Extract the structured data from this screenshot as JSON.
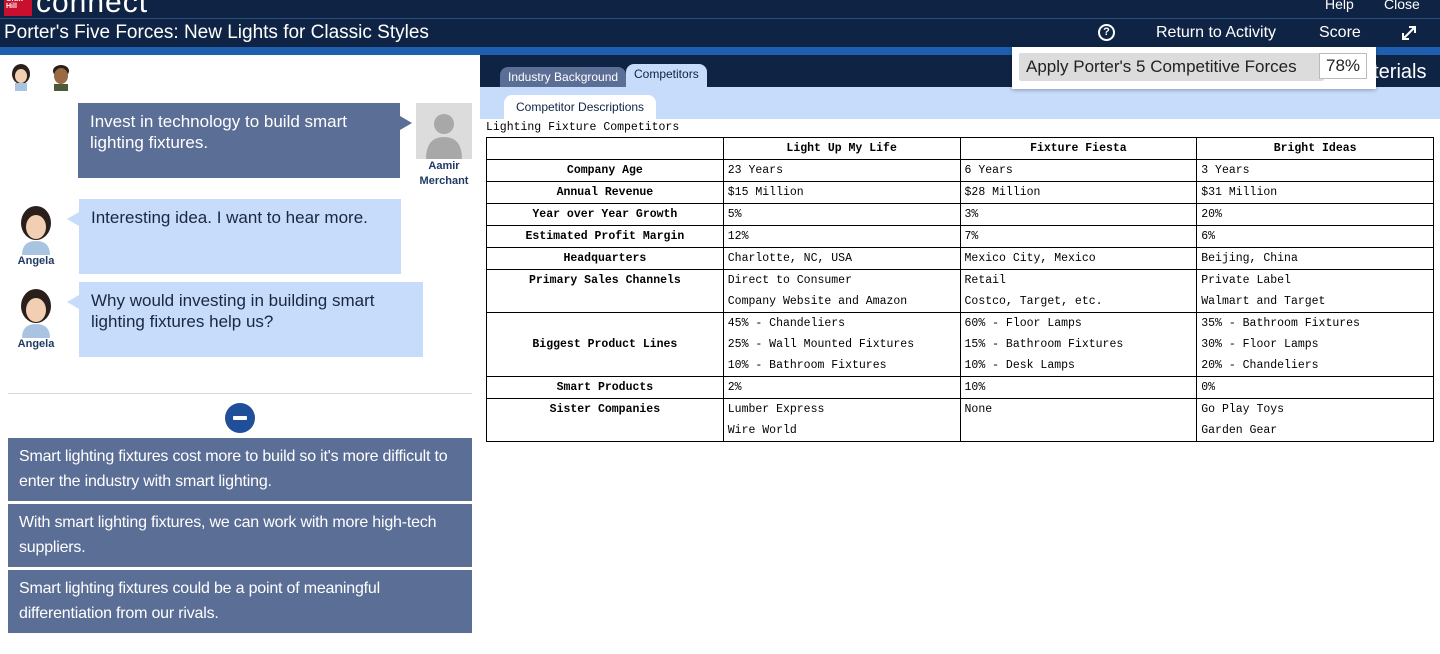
{
  "brand": {
    "logo_small": "Graw Hill",
    "logo_text": "connect",
    "help_label": "Help",
    "close_label": "Close"
  },
  "title_bar": {
    "title": "Porter's Five Forces: New Lights for Classic Styles",
    "help_symbol": "?",
    "return_label": "Return to Activity",
    "score_label": "Score"
  },
  "chat": {
    "messages": [
      {
        "speaker": "Aamir Merchant",
        "speaker_line1": "Aamir",
        "speaker_line2": "Merchant",
        "text": "Invest in technology to build smart lighting fixtures."
      },
      {
        "speaker": "Angela",
        "text": "Interesting idea. I want to hear more."
      },
      {
        "speaker": "Angela",
        "text": "Why would investing in building smart lighting fixtures help us?"
      }
    ],
    "options": [
      "Smart lighting fixtures cost more to build so it's more difficult to enter the industry with smart lighting.",
      "With smart lighting fixtures, we can work with more high-tech suppliers.",
      "Smart lighting fixtures could be a point of meaningful differentiation from our rivals."
    ]
  },
  "materials": {
    "tabs": [
      "Industry Background",
      "Competitors"
    ],
    "active_tab": "Competitors",
    "materials_label": "aterials",
    "subtab": "Competitor Descriptions"
  },
  "score_popup": {
    "label": "Apply Porter's 5 Competitive Forces",
    "value": "78%"
  },
  "table": {
    "caption": "Lighting Fixture Competitors",
    "columns": [
      "Light Up My Life",
      "Fixture Fiesta",
      "Bright Ideas"
    ],
    "rows": [
      {
        "label": "Company Age",
        "cells": [
          [
            "23 Years"
          ],
          [
            "6 Years"
          ],
          [
            "3 Years"
          ]
        ]
      },
      {
        "label": "Annual Revenue",
        "cells": [
          [
            "$15 Million"
          ],
          [
            "$28 Million"
          ],
          [
            "$31 Million"
          ]
        ]
      },
      {
        "label": "Year over Year Growth",
        "cells": [
          [
            "5%"
          ],
          [
            "3%"
          ],
          [
            "20%"
          ]
        ]
      },
      {
        "label": "Estimated Profit Margin",
        "cells": [
          [
            "12%"
          ],
          [
            "7%"
          ],
          [
            "6%"
          ]
        ]
      },
      {
        "label": "Headquarters",
        "cells": [
          [
            "Charlotte, NC, USA"
          ],
          [
            "Mexico City, Mexico"
          ],
          [
            "Beijing, China"
          ]
        ]
      },
      {
        "label": "Primary Sales Channels",
        "cells": [
          [
            "Direct to Consumer",
            "Company Website and Amazon"
          ],
          [
            "Retail",
            "Costco, Target, etc."
          ],
          [
            "Private Label",
            "Walmart and Target"
          ]
        ]
      },
      {
        "label": "Biggest Product Lines",
        "cells": [
          [
            "45% - Chandeliers",
            "25% - Wall Mounted Fixtures",
            "10% - Bathroom Fixtures"
          ],
          [
            "60% - Floor Lamps",
            "15% - Bathroom Fixtures",
            "10% - Desk Lamps"
          ],
          [
            "35% - Bathroom Fixtures",
            "30% - Floor Lamps",
            "20% - Chandeliers"
          ]
        ]
      },
      {
        "label": "Smart Products",
        "cells": [
          [
            "2%"
          ],
          [
            "10%"
          ],
          [
            "0%"
          ]
        ]
      },
      {
        "label": "Sister Companies",
        "cells": [
          [
            "Lumber Express",
            "Wire World"
          ],
          [
            "None"
          ],
          [
            "Go Play Toys",
            "Garden Gear"
          ]
        ]
      }
    ]
  }
}
